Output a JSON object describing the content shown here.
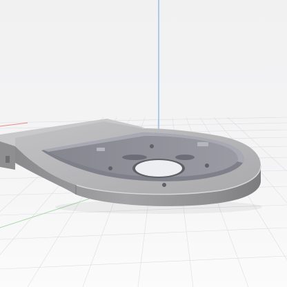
{
  "viewport": {
    "view": "3d-perspective",
    "background_top": "#f3f3f4",
    "background_bottom": "#ffffff",
    "grid_color": "#d6dadf",
    "axis_z_color": "#6aa0e6",
    "axis_x_color": "#e58a8a",
    "axis_y_color": "#8fcf8f"
  },
  "model": {
    "name": "",
    "body_color": "#9b9b9d",
    "top_face_color": "#b9b9bb",
    "pocket_floor_color": "#8e8f98",
    "highlight_color": "#cfcfd2"
  }
}
